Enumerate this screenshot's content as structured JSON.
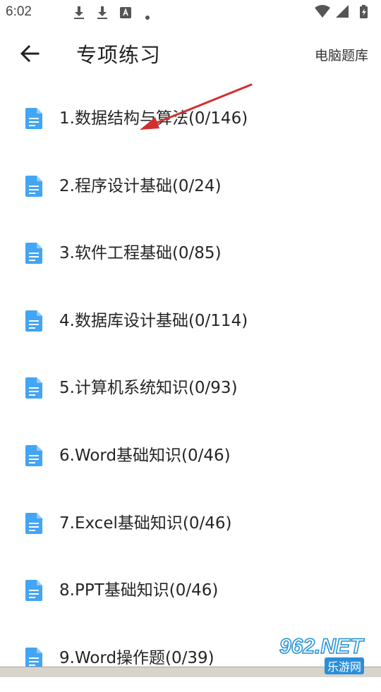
{
  "status_bar": {
    "time": "6:02"
  },
  "header": {
    "title": "专项练习",
    "action_label": "电脑题库"
  },
  "items": [
    {
      "label": "1.数据结构与算法(0/146)"
    },
    {
      "label": "2.程序设计基础(0/24)"
    },
    {
      "label": "3.软件工程基础(0/85)"
    },
    {
      "label": "4.数据库设计基础(0/114)"
    },
    {
      "label": "5.计算机系统知识(0/93)"
    },
    {
      "label": "6.Word基础知识(0/46)"
    },
    {
      "label": "7.Excel基础知识(0/46)"
    },
    {
      "label": "8.PPT基础知识(0/46)"
    },
    {
      "label": "9.Word操作题(0/39)"
    }
  ],
  "watermark": {
    "main": "962.NET",
    "sub": "乐游网"
  },
  "colors": {
    "doc_icon": "#42a5f5",
    "arrow": "#d32f2f"
  },
  "icons": [
    "back-arrow-icon",
    "document-icon",
    "download-icon",
    "keyboard-a-icon",
    "wifi-icon",
    "signal-icon",
    "battery-icon"
  ]
}
